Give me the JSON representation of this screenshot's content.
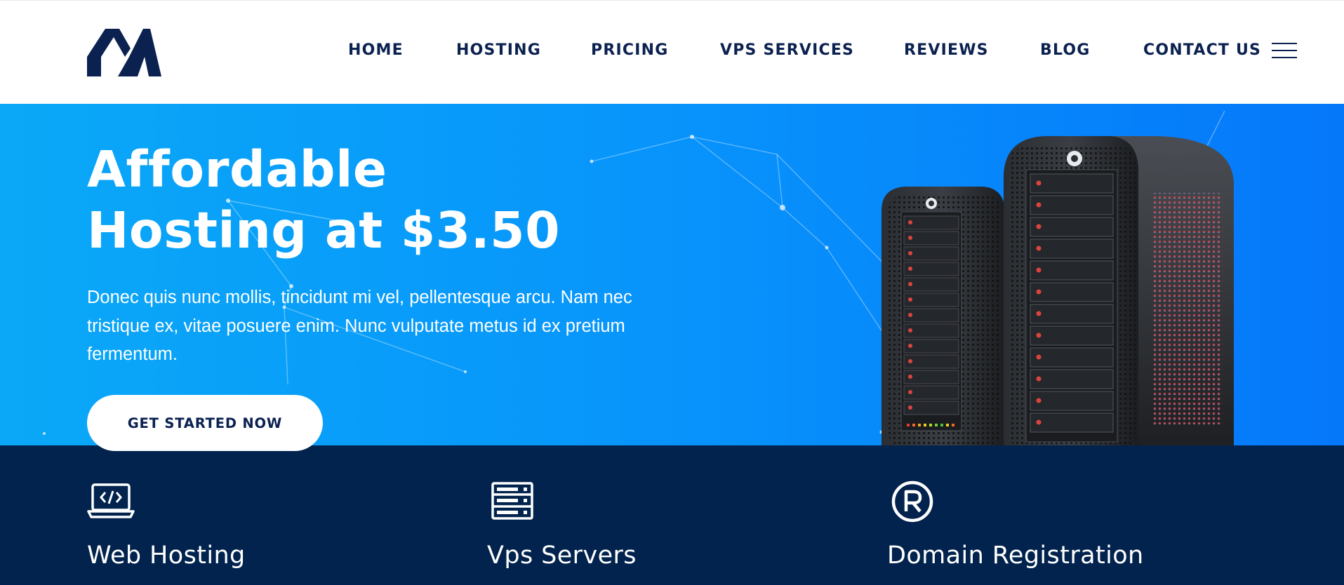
{
  "header": {
    "logo_icon": "brand-logo-m",
    "nav": [
      {
        "label": "HOME"
      },
      {
        "label": "HOSTING"
      },
      {
        "label": "PRICING"
      },
      {
        "label": "VPS SERVICES"
      },
      {
        "label": "REVIEWS"
      },
      {
        "label": "BLOG"
      },
      {
        "label": "CONTACT US"
      }
    ],
    "menu_icon": "hamburger-icon"
  },
  "hero": {
    "title_line1": "Affordable",
    "title_line2": "Hosting at $3.50",
    "text": "Donec quis nunc mollis, tincidunt mi vel, pellentesque arcu. Nam nec tristique ex, vitae posuere enim. Nunc vulputate metus id ex pretium fermentum.",
    "cta_label": "GET STARTED NOW",
    "image": "server-towers-illustration"
  },
  "features": [
    {
      "title": "Web Hosting",
      "icon": "laptop-code-icon"
    },
    {
      "title": "Vps Servers",
      "icon": "server-rack-icon"
    },
    {
      "title": "Domain Registration",
      "icon": "registered-trademark-icon"
    }
  ],
  "colors": {
    "navy": "#0b2150",
    "band": "#02234d",
    "hero_start": "#0aa8f7",
    "hero_end": "#0578fa",
    "white": "#ffffff"
  }
}
